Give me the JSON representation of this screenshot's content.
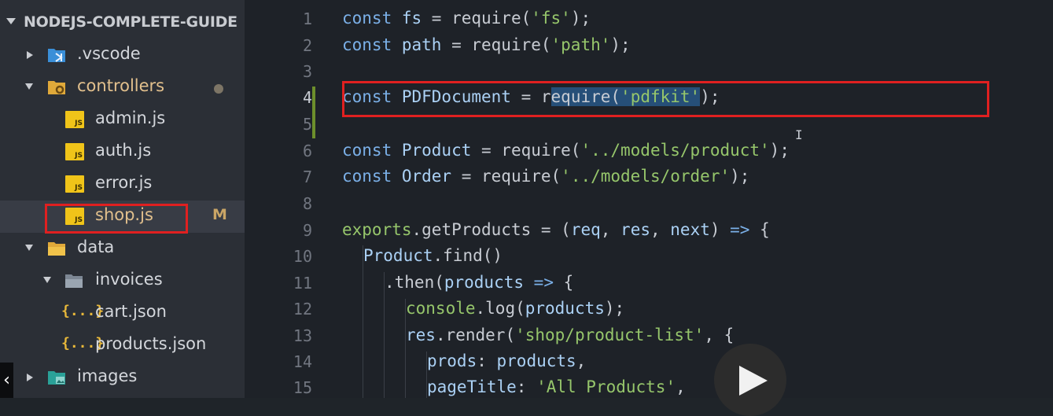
{
  "explorer": {
    "project_title": "NODEJS-COMPLETE-GUIDE",
    "items": [
      {
        "label": ".vscode",
        "icon": "vscode-folder-icon"
      },
      {
        "label": "controllers",
        "icon": "settings-folder-icon"
      },
      {
        "label": "admin.js",
        "icon": "js-file-icon"
      },
      {
        "label": "auth.js",
        "icon": "js-file-icon"
      },
      {
        "label": "error.js",
        "icon": "js-file-icon"
      },
      {
        "label": "shop.js",
        "icon": "js-file-icon",
        "status": "M"
      },
      {
        "label": "data",
        "icon": "folder-icon"
      },
      {
        "label": "invoices",
        "icon": "folder-icon"
      },
      {
        "label": "cart.json",
        "icon": "json-file-icon"
      },
      {
        "label": "products.json",
        "icon": "json-file-icon"
      },
      {
        "label": "images",
        "icon": "image-folder-icon"
      }
    ],
    "js_icon_text": "JS",
    "json_icon_text": "{...}"
  },
  "editor": {
    "line_numbers": [
      "1",
      "2",
      "3",
      "4",
      "5",
      "6",
      "7",
      "8",
      "9",
      "10",
      "11",
      "12",
      "13",
      "14",
      "15"
    ],
    "lines": {
      "l1": {
        "kw": "const",
        "a": " fs ",
        "b": "= require(",
        "s": "'fs'",
        "c": ");"
      },
      "l2": {
        "kw": "const",
        "a": " path ",
        "b": "= require(",
        "s": "'path'",
        "c": ");"
      },
      "l4": {
        "kw": "const",
        "a": " PDFDocument ",
        "b": "= r",
        "sel": "equire(",
        "s": "'pdfkit'",
        "c": ");"
      },
      "l6": {
        "kw": "const",
        "a": " Product ",
        "b": "= require(",
        "s": "'../models/product'",
        "c": ");"
      },
      "l7": {
        "kw": "const",
        "a": " Order ",
        "b": "= require(",
        "s": "'../models/order'",
        "c": ");"
      },
      "l9": {
        "a": "exports",
        "b": ".getProducts = (",
        "c": "req",
        "d": ", ",
        "e": "res",
        "f": ", ",
        "g": "next",
        "h": ") ",
        "arrow": "=>",
        "i": " {"
      },
      "l10": {
        "a": "Product",
        "b": ".find()"
      },
      "l11": {
        "a": ".then(",
        "b": "products",
        "c": " ",
        "arrow": "=>",
        "d": " {"
      },
      "l12": {
        "a": "console",
        "b": ".log(",
        "c": "products",
        "d": ");"
      },
      "l13": {
        "a": "res",
        "b": ".render(",
        "s": "'shop/product-list'",
        "c": ", {"
      },
      "l14": {
        "a": "prods",
        "b": ": ",
        "c": "products",
        "d": ","
      },
      "l15": {
        "a": "pageTitle",
        "b": ": ",
        "s": "'All Products'",
        "c": ","
      }
    }
  },
  "overlay": {
    "play_label": "play-video",
    "back_glyph": "‹"
  },
  "colors": {
    "keyword": "#7bb0e8",
    "string": "#96c66b",
    "highlight_box": "#e02020"
  }
}
